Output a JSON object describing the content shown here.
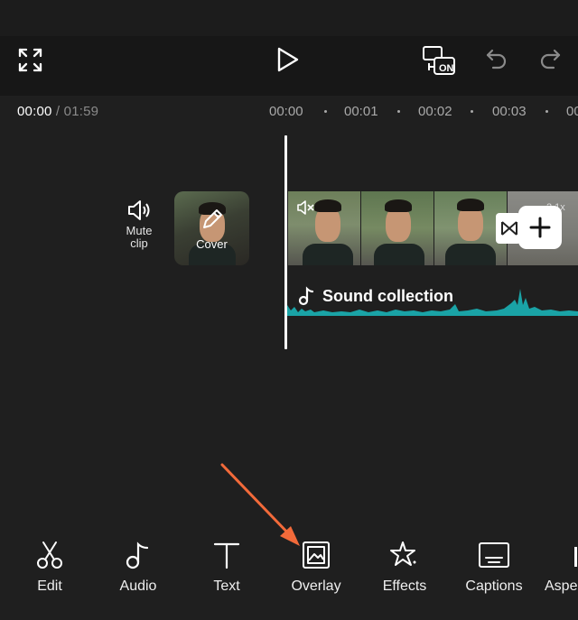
{
  "toolbar": {
    "fullscreen_icon": "fullscreen-expand-icon",
    "play_icon": "play-icon",
    "toggle_icon": "display-on-toggle-icon",
    "toggle_badge": "ON",
    "undo_icon": "undo-icon",
    "redo_icon": "redo-icon"
  },
  "time": {
    "current": "00:00",
    "separator": " / ",
    "total": "01:59"
  },
  "ruler": {
    "marks": [
      "00:00",
      "00:01",
      "00:02",
      "00:03",
      "00:0"
    ]
  },
  "timeline": {
    "mute_label_line1": "Mute",
    "mute_label_line2": "clip",
    "cover_label": "Cover",
    "speed_badge": "2.1x",
    "audio_track_label": "Sound collection"
  },
  "tabs": [
    {
      "label": "Edit",
      "icon": "scissors-icon"
    },
    {
      "label": "Audio",
      "icon": "music-note-icon"
    },
    {
      "label": "Text",
      "icon": "text-icon"
    },
    {
      "label": "Overlay",
      "icon": "overlay-icon"
    },
    {
      "label": "Effects",
      "icon": "effects-star-icon"
    },
    {
      "label": "Captions",
      "icon": "captions-icon"
    },
    {
      "label": "Aspe",
      "icon": "aspect-ratio-icon"
    }
  ],
  "colors": {
    "background": "#1f1f1f",
    "toolbar": "#171717",
    "audio_wave": "#1aa3a6",
    "annotation_arrow": "#f26a3a"
  }
}
